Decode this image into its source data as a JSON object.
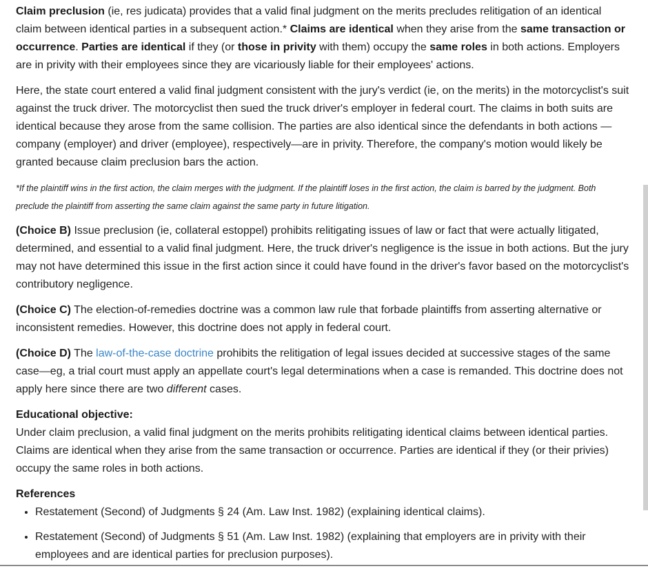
{
  "p1": {
    "t1": "Claim preclusion",
    "t2": " (ie, res judicata) provides that a valid final judgment on the merits precludes relitigation of an identical claim between identical parties in a subsequent action.* ",
    "t3": "Claims are identical",
    "t4": " when they arise from the ",
    "t5": "same transaction or occurrence",
    "t6": ". ",
    "t7": "Parties are identical",
    "t8": " if they (or ",
    "t9": "those in privity",
    "t10": " with them) occupy the ",
    "t11": "same roles",
    "t12": " in both actions. Employers are in privity with their employees since they are vicariously liable for their employees' actions."
  },
  "p2": "Here, the state court entered a valid final judgment consistent with the jury's verdict (ie, on the merits) in the motorcyclist's suit against the truck driver. The motorcyclist then sued the truck driver's employer in federal court. The claims in both suits are identical because they arose from the same collision. The parties are also identical since the defendants in both actions —company (employer) and driver (employee), respectively—are in privity. Therefore, the company's motion would likely be granted because claim preclusion bars the action.",
  "footnote": "*If the plaintiff wins in the first action, the claim merges with the judgment. If the plaintiff loses in the first action, the claim is barred by the judgment. Both preclude the plaintiff from asserting the same claim against the same party in future litigation.",
  "choice_b": {
    "label": "(Choice B)",
    "text": " Issue preclusion (ie, collateral estoppel) prohibits relitigating issues of law or fact that were actually litigated, determined, and essential to a valid final judgment. Here, the truck driver's negligence is the issue in both actions. But the jury may not have determined this issue in the first action since it could have found in the driver's favor based on the motorcyclist's contributory negligence."
  },
  "choice_c": {
    "label": "(Choice C)",
    "text": " The election-of-remedies doctrine was a common law rule that forbade plaintiffs from asserting alternative or inconsistent remedies. However, this doctrine does not apply in federal court."
  },
  "choice_d": {
    "label": "(Choice D)",
    "t1": " The ",
    "link": "law-of-the-case doctrine",
    "t2": " prohibits the relitigation of legal issues decided at successive stages of the same case—eg, a trial court must apply an appellate court's legal determinations when a case is remanded. This doctrine does not apply here since there are two ",
    "em": "different",
    "t3": " cases."
  },
  "objective": {
    "heading": "Educational objective:",
    "text": "Under claim preclusion, a valid final judgment on the merits prohibits relitigating identical claims between identical parties. Claims are identical when they arise from the same transaction or occurrence. Parties are identical if they (or their privies) occupy the same roles in both actions."
  },
  "references": {
    "heading": "References",
    "items": [
      "Restatement (Second) of Judgments § 24 (Am. Law Inst. 1982) (explaining identical claims).",
      "Restatement (Second) of Judgments § 51 (Am. Law Inst. 1982) (explaining that employers are in privity with their employees and are identical parties for preclusion purposes)."
    ]
  },
  "colors": {
    "text": "#222222",
    "link": "#3a86c8",
    "scrollbar": "#d0d0d0"
  }
}
